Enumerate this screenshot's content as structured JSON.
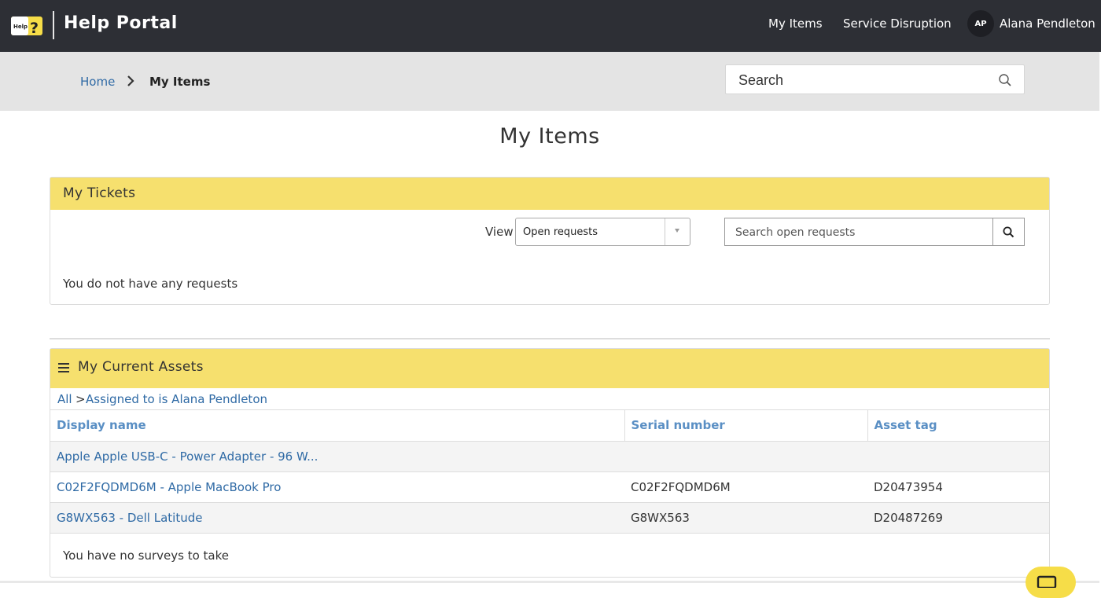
{
  "header": {
    "logo_icon": "help-logo-icon",
    "title": "Help Portal",
    "nav": {
      "my_items": "My Items",
      "service_disruption": "Service Disruption"
    },
    "user": {
      "initials": "AP",
      "name": "Alana Pendleton"
    }
  },
  "breadcrumb": {
    "home": "Home",
    "separator_icon": "chevron-right-icon",
    "current": "My Items"
  },
  "search": {
    "placeholder": "Search",
    "icon": "search-icon"
  },
  "page": {
    "title": "My Items"
  },
  "tickets": {
    "title": "My Tickets",
    "view_label": "View",
    "view_selected": "Open requests",
    "search_placeholder": "Search open requests",
    "empty_message": "You do not have any requests"
  },
  "assets": {
    "title": "My Current Assets",
    "filter": {
      "all": "All",
      "separator": ">",
      "condition": "Assigned to is Alana Pendleton"
    },
    "columns": [
      "Display name",
      "Serial number",
      "Asset tag"
    ],
    "rows": [
      {
        "display_name": "Apple Apple USB-C - Power Adapter - 96 W...",
        "serial_number": "",
        "asset_tag": ""
      },
      {
        "display_name": "C02F2FQDMD6M - Apple MacBook Pro",
        "serial_number": "C02F2FQDMD6M",
        "asset_tag": "D20473954"
      },
      {
        "display_name": "G8WX563 - Dell Latitude",
        "serial_number": "G8WX563",
        "asset_tag": "D20487269"
      }
    ]
  },
  "surveys": {
    "empty_message": "You have no surveys to take"
  },
  "colors": {
    "topbar": "#2d2f35",
    "panel_header": "#f6e06e",
    "link": "#2f6aa5",
    "chat_button": "#f6dd48"
  }
}
